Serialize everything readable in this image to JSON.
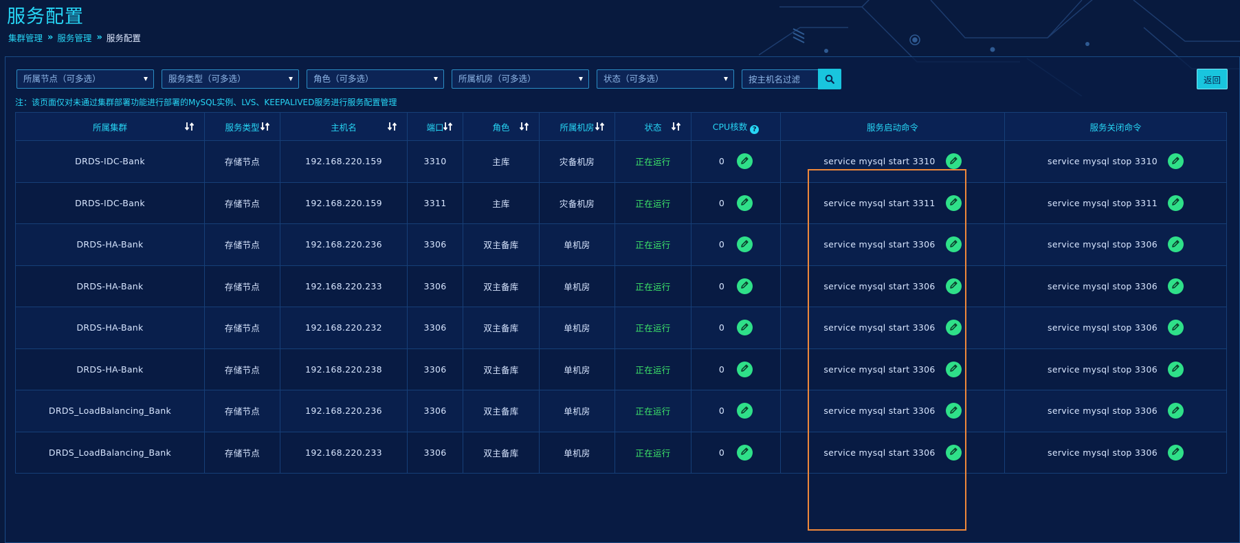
{
  "page": {
    "title": "服务配置",
    "breadcrumb": [
      "集群管理",
      "服务管理",
      "服务配置"
    ]
  },
  "filters": [
    {
      "placeholder": "所属节点（可多选）"
    },
    {
      "placeholder": "服务类型（可多选）"
    },
    {
      "placeholder": "角色（可多选）"
    },
    {
      "placeholder": "所属机房（可多选）"
    },
    {
      "placeholder": "状态（可多选）"
    }
  ],
  "search": {
    "placeholder": "按主机名过滤"
  },
  "back_label": "返回",
  "note": "注：该页面仅对未通过集群部署功能进行部署的MySQL实例、LVS、KEEPALIVED服务进行服务配置管理",
  "table": {
    "headers": [
      "所属集群",
      "服务类型",
      "主机名",
      "端口",
      "角色",
      "所属机房",
      "状态",
      "CPU核数",
      "服务启动命令",
      "服务关闭命令"
    ],
    "rows": [
      {
        "cluster": "DRDS-IDC-Bank",
        "type": "存储节点",
        "host": "192.168.220.159",
        "port": "3310",
        "role": "主库",
        "room": "灾备机房",
        "status": "正在运行",
        "cpu": "0",
        "start_cmd": "service mysql start 3310",
        "stop_cmd": "service mysql stop 3310"
      },
      {
        "cluster": "DRDS-IDC-Bank",
        "type": "存储节点",
        "host": "192.168.220.159",
        "port": "3311",
        "role": "主库",
        "room": "灾备机房",
        "status": "正在运行",
        "cpu": "0",
        "start_cmd": "service mysql start 3311",
        "stop_cmd": "service mysql stop 3311"
      },
      {
        "cluster": "DRDS-HA-Bank",
        "type": "存储节点",
        "host": "192.168.220.236",
        "port": "3306",
        "role": "双主备库",
        "room": "单机房",
        "status": "正在运行",
        "cpu": "0",
        "start_cmd": "service mysql start 3306",
        "stop_cmd": "service mysql stop 3306"
      },
      {
        "cluster": "DRDS-HA-Bank",
        "type": "存储节点",
        "host": "192.168.220.233",
        "port": "3306",
        "role": "双主备库",
        "room": "单机房",
        "status": "正在运行",
        "cpu": "0",
        "start_cmd": "service mysql start 3306",
        "stop_cmd": "service mysql stop 3306"
      },
      {
        "cluster": "DRDS-HA-Bank",
        "type": "存储节点",
        "host": "192.168.220.232",
        "port": "3306",
        "role": "双主备库",
        "room": "单机房",
        "status": "正在运行",
        "cpu": "0",
        "start_cmd": "service mysql start 3306",
        "stop_cmd": "service mysql stop 3306"
      },
      {
        "cluster": "DRDS-HA-Bank",
        "type": "存储节点",
        "host": "192.168.220.238",
        "port": "3306",
        "role": "双主备库",
        "room": "单机房",
        "status": "正在运行",
        "cpu": "0",
        "start_cmd": "service mysql start 3306",
        "stop_cmd": "service mysql stop 3306"
      },
      {
        "cluster": "DRDS_LoadBalancing_Bank",
        "type": "存储节点",
        "host": "192.168.220.236",
        "port": "3306",
        "role": "双主备库",
        "room": "单机房",
        "status": "正在运行",
        "cpu": "0",
        "start_cmd": "service mysql start 3306",
        "stop_cmd": "service mysql stop 3306"
      },
      {
        "cluster": "DRDS_LoadBalancing_Bank",
        "type": "存储节点",
        "host": "192.168.220.233",
        "port": "3306",
        "role": "双主备库",
        "room": "单机房",
        "status": "正在运行",
        "cpu": "0",
        "start_cmd": "service mysql start 3306",
        "stop_cmd": "service mysql stop 3306"
      }
    ]
  },
  "icons": {
    "sort": "sort-icon",
    "edit": "pencil-icon",
    "help": "help-icon",
    "search": "search-icon",
    "dropdown": "chevron-down-icon"
  },
  "colors": {
    "accent": "#27d6f5",
    "status_running": "#3ee86a",
    "edit_button": "#2fe089",
    "highlight": "#f0883a"
  }
}
